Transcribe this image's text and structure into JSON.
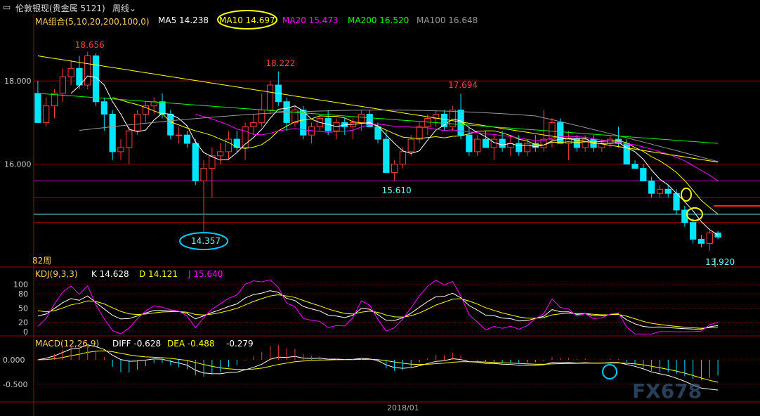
{
  "header": {
    "title": "伦敦银现(贵金属 5121)",
    "period": "周线"
  },
  "colors": {
    "up": "#ff3b3b",
    "down": "#00e5ff",
    "ma5": "#ffffff",
    "ma10": "#ffff00",
    "ma20": "#ff00ff",
    "ma200": "#00ff00",
    "ma100": "#999999",
    "grid": "#a00000"
  },
  "legend_main": {
    "group": "MA组合(5,10,20,200,100,0)",
    "ma5": "MA5 14.238",
    "ma10": "MA10 14.697",
    "ma20": "MA20 15.473",
    "ma200": "MA200 16.520",
    "ma100": "MA100 16.648"
  },
  "legend_kdj": {
    "group": "KDJ(9,3,3)",
    "k": "K 14.628",
    "d": "D 14.121",
    "j": "J 15.640"
  },
  "legend_macd": {
    "group": "MACD(12,26,9)",
    "diff": "DIFF -0.628",
    "dea": "DEA -0.488",
    "macd": "-0.279"
  },
  "bars_label": "82周",
  "date_label": "2018/01",
  "watermark": "FX678",
  "chart_data": {
    "type": "candlestick",
    "price_ylim": [
      13.6,
      19.3
    ],
    "price_ticks": [
      "18.000",
      "16.000"
    ],
    "annotations": [
      "18.656",
      "18.222",
      "17.694",
      "15.610",
      "14.357",
      "13.920"
    ],
    "ohlc": [
      [
        17.7,
        18.0,
        17.0,
        17.0
      ],
      [
        17.0,
        17.6,
        16.9,
        17.4
      ],
      [
        17.4,
        17.8,
        17.1,
        17.7
      ],
      [
        17.7,
        18.3,
        17.5,
        18.1
      ],
      [
        18.1,
        18.5,
        17.9,
        18.3
      ],
      [
        18.3,
        18.6,
        17.8,
        17.9
      ],
      [
        17.9,
        18.7,
        17.8,
        18.6
      ],
      [
        18.6,
        18.66,
        17.4,
        17.5
      ],
      [
        17.5,
        17.6,
        16.8,
        17.2
      ],
      [
        17.2,
        17.3,
        16.1,
        16.3
      ],
      [
        16.3,
        16.6,
        16.1,
        16.4
      ],
      [
        16.4,
        16.9,
        16.0,
        16.8
      ],
      [
        16.8,
        17.3,
        16.7,
        17.2
      ],
      [
        17.2,
        17.5,
        17.0,
        17.4
      ],
      [
        17.4,
        17.6,
        17.2,
        17.5
      ],
      [
        17.5,
        17.7,
        17.1,
        17.2
      ],
      [
        17.2,
        17.3,
        16.6,
        16.7
      ],
      [
        16.7,
        16.9,
        16.5,
        16.7
      ],
      [
        16.7,
        16.8,
        16.4,
        16.5
      ],
      [
        16.5,
        16.6,
        15.5,
        15.6
      ],
      [
        15.6,
        16.1,
        14.357,
        15.9
      ],
      [
        15.9,
        16.4,
        15.2,
        16.2
      ],
      [
        16.2,
        16.5,
        16.0,
        16.3
      ],
      [
        16.3,
        16.8,
        16.1,
        16.6
      ],
      [
        16.6,
        16.8,
        16.3,
        16.4
      ],
      [
        16.4,
        17.0,
        16.1,
        16.9
      ],
      [
        16.9,
        17.2,
        16.7,
        17.0
      ],
      [
        17.0,
        17.7,
        16.9,
        17.3
      ],
      [
        17.3,
        18.0,
        17.2,
        17.9
      ],
      [
        17.9,
        18.222,
        17.4,
        17.5
      ],
      [
        17.5,
        17.6,
        16.8,
        17.0
      ],
      [
        17.0,
        17.4,
        16.9,
        17.3
      ],
      [
        17.3,
        17.4,
        16.6,
        16.7
      ],
      [
        16.7,
        17.0,
        16.5,
        16.9
      ],
      [
        16.9,
        17.2,
        16.8,
        17.1
      ],
      [
        17.1,
        17.3,
        16.7,
        16.8
      ],
      [
        16.8,
        17.1,
        16.6,
        17.0
      ],
      [
        17.0,
        17.1,
        16.7,
        16.9
      ],
      [
        16.9,
        17.1,
        16.6,
        17.0
      ],
      [
        17.0,
        17.3,
        16.8,
        17.2
      ],
      [
        17.2,
        17.3,
        16.9,
        16.9
      ],
      [
        16.9,
        17.0,
        16.5,
        16.6
      ],
      [
        16.6,
        16.8,
        15.8,
        15.8
      ],
      [
        15.8,
        16.1,
        15.61,
        16.0
      ],
      [
        16.0,
        16.4,
        15.9,
        16.3
      ],
      [
        16.3,
        16.7,
        16.2,
        16.6
      ],
      [
        16.6,
        17.0,
        16.5,
        16.9
      ],
      [
        16.9,
        17.2,
        16.7,
        17.1
      ],
      [
        17.1,
        17.3,
        16.9,
        17.2
      ],
      [
        17.2,
        17.3,
        16.8,
        16.9
      ],
      [
        16.9,
        17.4,
        16.8,
        17.3
      ],
      [
        17.3,
        17.694,
        16.6,
        16.7
      ],
      [
        16.7,
        16.9,
        16.2,
        16.3
      ],
      [
        16.3,
        16.7,
        16.2,
        16.6
      ],
      [
        16.6,
        16.8,
        16.4,
        16.4
      ],
      [
        16.4,
        16.7,
        16.1,
        16.6
      ],
      [
        16.6,
        16.8,
        16.3,
        16.4
      ],
      [
        16.4,
        16.7,
        16.2,
        16.5
      ],
      [
        16.5,
        16.7,
        16.2,
        16.3
      ],
      [
        16.3,
        16.6,
        16.2,
        16.5
      ],
      [
        16.5,
        16.7,
        16.3,
        16.4
      ],
      [
        16.4,
        17.3,
        16.3,
        16.6
      ],
      [
        16.6,
        17.1,
        16.4,
        17.0
      ],
      [
        17.0,
        17.1,
        16.5,
        16.5
      ],
      [
        16.5,
        16.8,
        16.1,
        16.6
      ],
      [
        16.6,
        16.7,
        16.3,
        16.4
      ],
      [
        16.4,
        16.7,
        16.3,
        16.6
      ],
      [
        16.6,
        16.7,
        16.3,
        16.4
      ],
      [
        16.4,
        16.6,
        16.3,
        16.5
      ],
      [
        16.5,
        16.7,
        16.4,
        16.6
      ],
      [
        16.6,
        16.9,
        16.4,
        16.5
      ],
      [
        16.5,
        16.6,
        16.0,
        16.0
      ],
      [
        16.0,
        16.1,
        15.9,
        15.9
      ],
      [
        15.9,
        16.0,
        15.6,
        15.6
      ],
      [
        15.6,
        15.7,
        15.2,
        15.3
      ],
      [
        15.3,
        15.5,
        15.2,
        15.4
      ],
      [
        15.4,
        15.5,
        15.2,
        15.3
      ],
      [
        15.3,
        15.4,
        14.8,
        14.9
      ],
      [
        14.9,
        15.0,
        14.5,
        14.6
      ],
      [
        14.6,
        14.7,
        14.1,
        14.2
      ],
      [
        14.2,
        14.3,
        14.0,
        14.1
      ],
      [
        14.1,
        14.4,
        13.92,
        14.35
      ],
      [
        14.35,
        14.4,
        14.2,
        14.25
      ]
    ],
    "kdj_ticks": [
      "100",
      "80",
      "50",
      "20",
      "0"
    ],
    "macd_ticks": [
      "0.000",
      "-0.500"
    ]
  }
}
